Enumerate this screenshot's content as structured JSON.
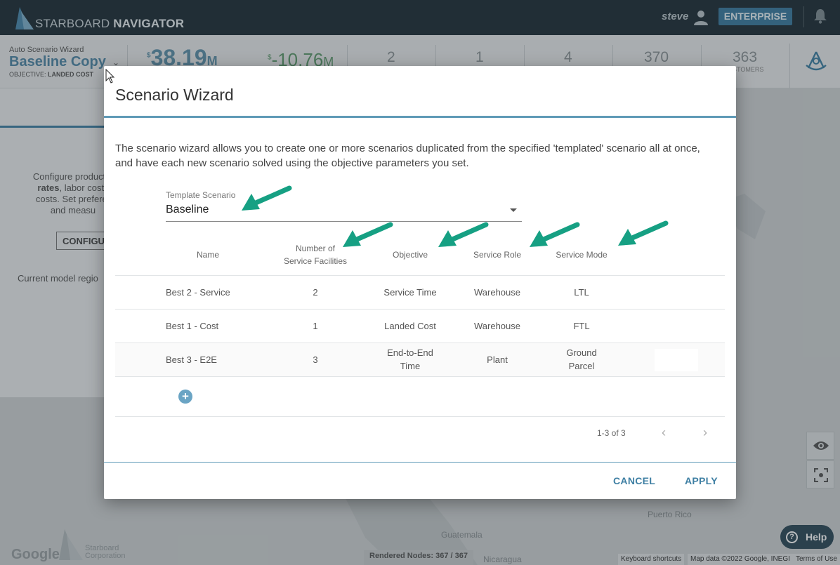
{
  "app": {
    "brand_prefix": "STARBOARD",
    "brand_suffix": "NAVIGATOR",
    "user": "steve",
    "plan_badge": "ENTERPRISE"
  },
  "scenario_header": {
    "wizard_label": "Auto Scenario Wizard",
    "scenario_name": "Baseline Copy",
    "objective_prefix": "OBJECTIVE:",
    "objective_value": "LANDED COST"
  },
  "stats": {
    "total_cost": {
      "currency": "$",
      "value": "38.19",
      "unit": "M"
    },
    "delta_cost": {
      "currency": "$",
      "value": "-10.76",
      "unit": "M"
    },
    "counts": [
      "2",
      "1",
      "4",
      "370",
      "363"
    ],
    "last_label_partial": "STOMERS"
  },
  "left_panel": {
    "line1": "Configure product d",
    "line2_bold": "rates",
    "line2_rest": ", labor costs",
    "line3": "costs. Set preferer",
    "line4": "and measu",
    "button": "CONFIGUR",
    "region_text": "Current model regio"
  },
  "map": {
    "google": "Google",
    "corp_line1": "Starboard",
    "corp_line2": "Corporation",
    "place_guatemala": "Guatemala",
    "place_nicaragua": "Nicaragua",
    "place_puerto_rico": "Puerto Rico",
    "rendered_nodes": "Rendered Nodes: 367 / 367",
    "attr_keyboard": "Keyboard shortcuts",
    "attr_mapdata": "Map data ©2022 Google, INEGI",
    "attr_terms": "Terms of Use",
    "help_label": "Help"
  },
  "dialog": {
    "title": "Scenario Wizard",
    "description": "The scenario wizard allows you to create one or more scenarios duplicated from the specified 'templated' scenario all at once, and have each new scenario solved using the objective parameters you set.",
    "template_label": "Template Scenario",
    "template_value": "Baseline",
    "columns": {
      "name": "Name",
      "facilities_line1": "Number of",
      "facilities_line2": "Service Facilities",
      "objective": "Objective",
      "role": "Service Role",
      "mode": "Service Mode"
    },
    "rows": [
      {
        "name": "Best 2 - Service",
        "facilities": "2",
        "objective": "Service Time",
        "role": "Warehouse",
        "mode": "LTL"
      },
      {
        "name": "Best 1 - Cost",
        "facilities": "1",
        "objective": "Landed Cost",
        "role": "Warehouse",
        "mode": "FTL"
      },
      {
        "name": "Best 3 - E2E",
        "facilities": "3",
        "objective_line1": "End-to-End",
        "objective_line2": "Time",
        "role": "Plant",
        "mode_line1": "Ground",
        "mode_line2": "Parcel"
      }
    ],
    "pagination": "1-3 of 3",
    "cancel": "CANCEL",
    "apply": "APPLY"
  },
  "colors": {
    "accent": "#3e7fa3",
    "arrow": "#16a083",
    "topbar": "#1f2e36"
  }
}
